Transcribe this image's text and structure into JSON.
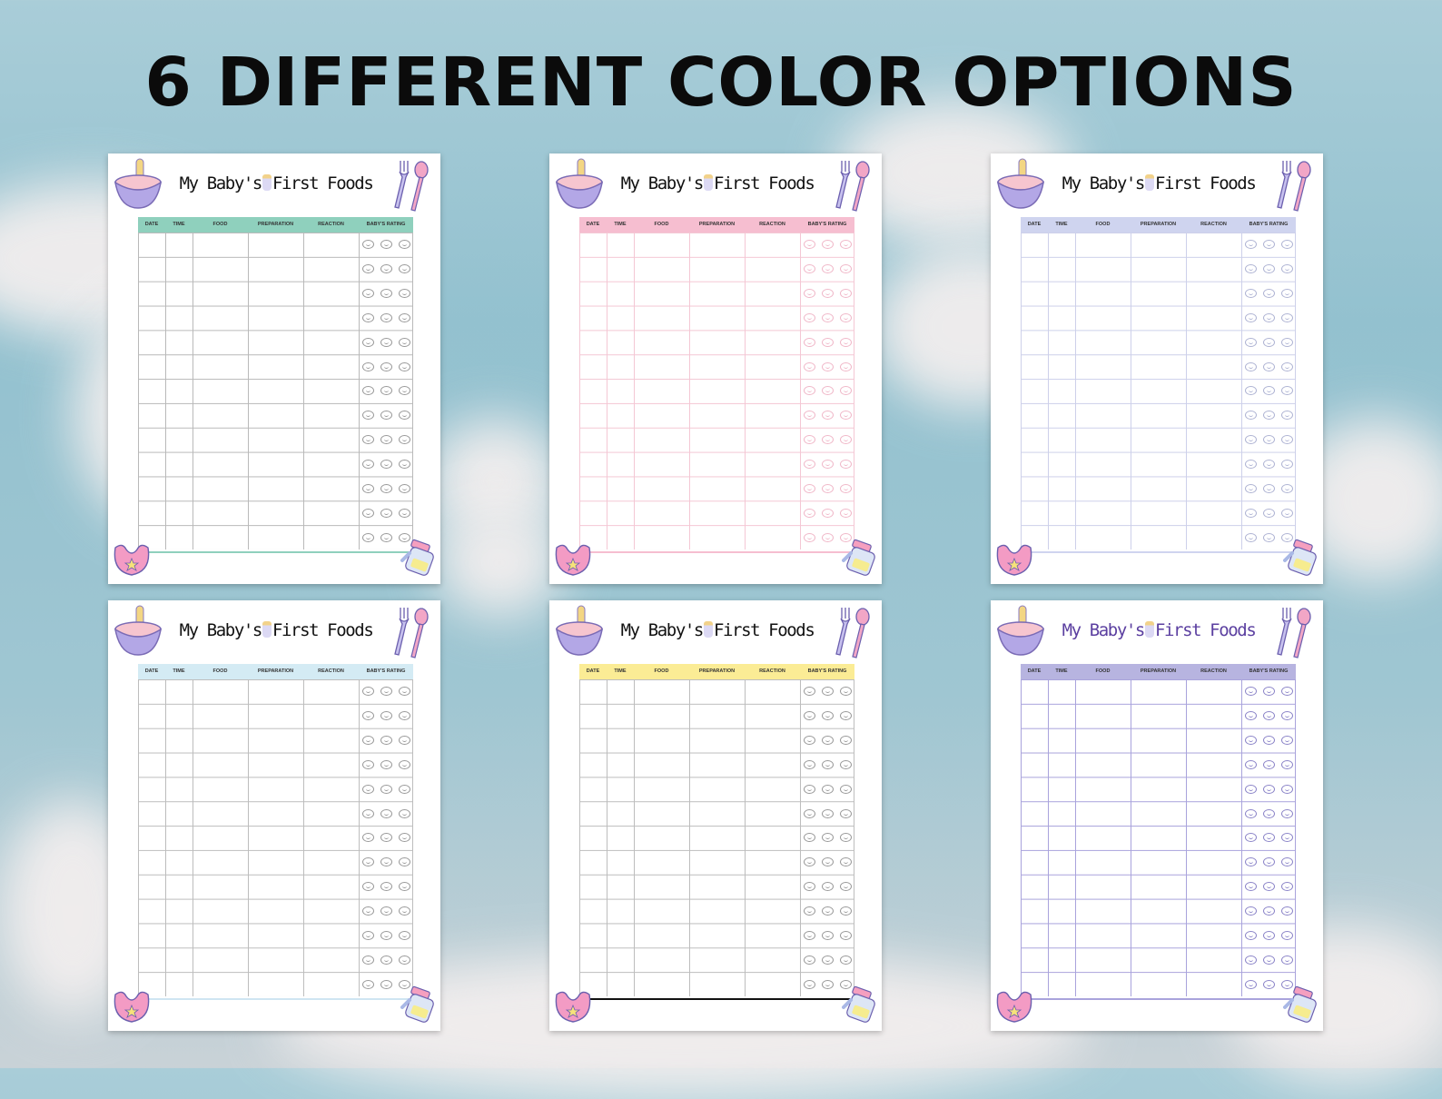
{
  "headline": "6 DIFFERENT COLOR OPTIONS",
  "sheets": [
    {
      "title": {
        "part1": "My Baby's",
        "part2": "First Foods"
      },
      "columns": [
        "DATE",
        "TIME",
        "FOOD",
        "PREPARATION",
        "REACTION",
        "BABY'S RATING"
      ],
      "colors": {
        "header": "#8fd0bd",
        "line": "#b9b9b9",
        "bar": "#8fd0bd",
        "face": "#999999",
        "title": "#111111"
      }
    },
    {
      "title": {
        "part1": "My Baby's",
        "part2": "First Foods"
      },
      "columns": [
        "DATE",
        "TIME",
        "FOOD",
        "PREPARATION",
        "REACTION",
        "BABY'S RATING"
      ],
      "colors": {
        "header": "#f6bed0",
        "line": "#f4c7d4",
        "bar": "#f6bed0",
        "face": "#f0b7c8",
        "title": "#111111"
      }
    },
    {
      "title": {
        "part1": "My Baby's",
        "part2": "First Foods"
      },
      "columns": [
        "DATE",
        "TIME",
        "FOOD",
        "PREPARATION",
        "REACTION",
        "BABY'S RATING"
      ],
      "colors": {
        "header": "#cfd4ef",
        "line": "#cdd0ea",
        "bar": "#cfd4ef",
        "face": "#aeb3d3",
        "title": "#111111"
      }
    },
    {
      "title": {
        "part1": "My Baby's",
        "part2": "First Foods"
      },
      "columns": [
        "DATE",
        "TIME",
        "FOOD",
        "PREPARATION",
        "REACTION",
        "BABY'S RATING"
      ],
      "colors": {
        "header": "#d4ebf4",
        "line": "#bdbdbd",
        "bar": "#cfe5f2",
        "face": "#999999",
        "title": "#111111"
      }
    },
    {
      "title": {
        "part1": "My Baby's",
        "part2": "First Foods"
      },
      "columns": [
        "DATE",
        "TIME",
        "FOOD",
        "PREPARATION",
        "REACTION",
        "BABY'S RATING"
      ],
      "colors": {
        "header": "#fbec95",
        "line": "#bdbdbd",
        "bar": "#111111",
        "face": "#999999",
        "title": "#111111"
      }
    },
    {
      "title": {
        "part1": "My Baby's",
        "part2": "First Foods"
      },
      "columns": [
        "DATE",
        "TIME",
        "FOOD",
        "PREPARATION",
        "REACTION",
        "BABY'S RATING"
      ],
      "colors": {
        "header": "#b7b4e0",
        "line": "#a9a3dc",
        "bar": "#a9a3dc",
        "face": "#8b84c8",
        "title": "#5b3fa0"
      }
    }
  ]
}
